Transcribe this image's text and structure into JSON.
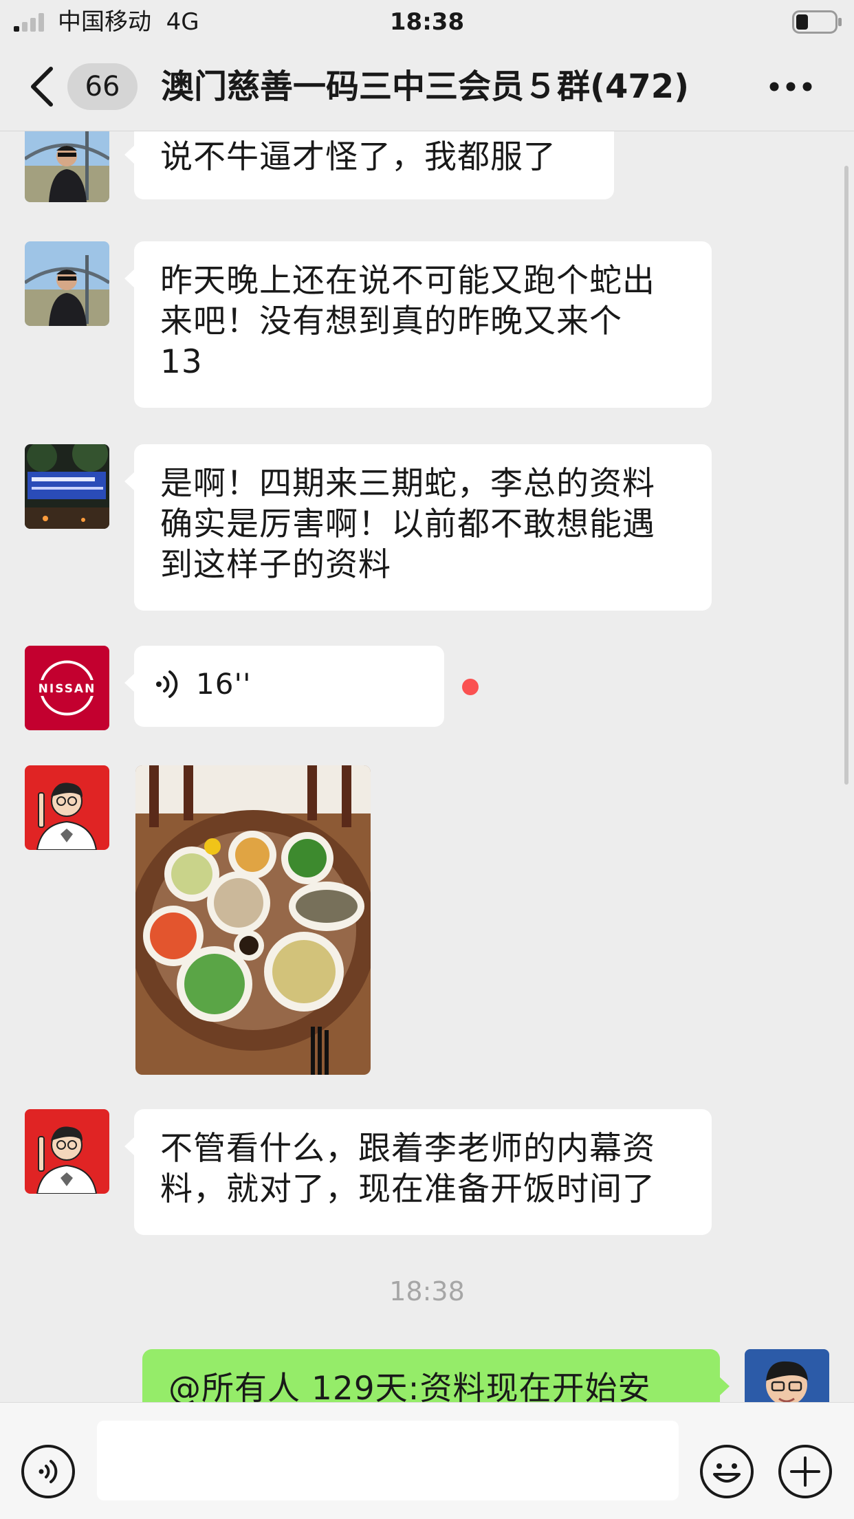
{
  "status_bar": {
    "carrier": "中国移动",
    "network": "4G",
    "time": "18:38"
  },
  "header": {
    "unread_count": "66",
    "title": "澳门慈善一码三中三会员５群(472)"
  },
  "messages": [
    {
      "type": "text",
      "sender_avatar": "man-in-suit-photo",
      "text": "说不牛逼才怪了，我都服了"
    },
    {
      "type": "text",
      "sender_avatar": "man-in-suit-photo",
      "text": "昨天晚上还在说不可能又跑个蛇出\n来吧！没有想到真的昨晚又来个\n13"
    },
    {
      "type": "text",
      "sender_avatar": "street-sign-photo",
      "text": "是啊！四期来三期蛇，李总的资料\n确实是厉害啊！以前都不敢想能遇\n到这样子的资料"
    },
    {
      "type": "voice",
      "sender_avatar": "nissan-logo",
      "duration": "16''",
      "unread": true
    },
    {
      "type": "image",
      "sender_avatar": "cartoon-man-avatar",
      "description": "food-on-table-photo"
    },
    {
      "type": "text",
      "sender_avatar": "cartoon-man-avatar",
      "text": "不管看什么，跟着李老师的内幕资\n料，就对了，现在准备开饭时间了"
    },
    {
      "type": "time",
      "text": "18:38"
    },
    {
      "type": "text",
      "self": true,
      "sender_avatar": "man-with-glasses-photo",
      "text": "@所有人 129天:资料现在开始安"
    }
  ],
  "input": {
    "value": "",
    "placeholder": ""
  },
  "colors": {
    "background": "#ededed",
    "self_bubble": "#95ec69",
    "unread_dot": "#fa5151",
    "nissan_red": "#c3002f"
  }
}
